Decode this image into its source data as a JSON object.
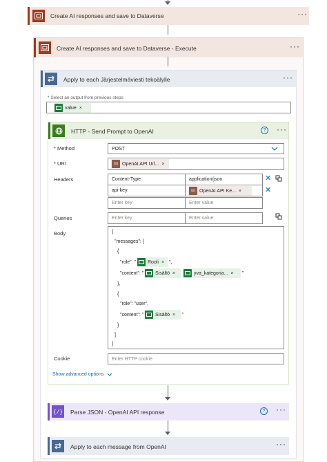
{
  "steps": {
    "create_ai": {
      "title": "Create AI responses and save to Dataverse",
      "menu": "···"
    },
    "create_ai_execute": {
      "title": "Create AI responses and save to Dataverse - Execute",
      "menu": "···"
    },
    "apply_each": {
      "title": "Apply to each Järjestelmäviesti tekoälylle",
      "menu": "···",
      "select_label": "* Select an output from previous steps",
      "selected_token": "value",
      "token_remove": "×"
    },
    "http": {
      "title": "HTTP - Send Prompt to OpenAI",
      "help": "?",
      "menu": "···",
      "method_label": "* Method",
      "method_value": "POST",
      "uri_label": "* URI",
      "uri_token": "OpenAI API Url...",
      "headers_label": "Headers",
      "headers": [
        {
          "key": "Content-Type",
          "value": "application/json"
        },
        {
          "key": "api-key",
          "value_token": "OpenAI API Ke..."
        }
      ],
      "enter_key": "Enter key",
      "enter_value": "Enter value",
      "queries_label": "Queries",
      "body_label": "Body",
      "body_lines": {
        "l1": "{",
        "l2": "\"messages\": [",
        "l3": "{",
        "l4_prefix": "\"role\": \"",
        "l4_token": "Rooli",
        "l4_suffix": "\",",
        "l5_prefix": "\"content\": \"",
        "l5_token1": "Sisältö",
        "l5_token2": "yva_kategoria...",
        "l5_suffix": "\"",
        "l6": "},",
        "l7": "{",
        "l8": "\"role\": \"user\",",
        "l9_prefix": "\"content\": \"",
        "l9_token": "Sisältö",
        "l9_suffix": "\"",
        "l10": "}",
        "l11": "]",
        "l12": "}"
      },
      "cookie_label": "Cookie",
      "cookie_placeholder": "Enter HTTP cookie",
      "show_advanced": "Show advanced options"
    },
    "parse_json": {
      "title": "Parse JSON - OpenAI API response",
      "help": "?",
      "menu": "···"
    },
    "apply_message": {
      "title": "Apply to each message from OpenAI",
      "menu": "···"
    }
  },
  "icons": {
    "dataverse": "dataverse-icon",
    "loop": "loop-icon",
    "http": "globe-icon",
    "parse": "code-braces-icon",
    "remove": "close-icon",
    "clear": "x-icon",
    "switch_mode": "switch-mode-icon"
  },
  "colors": {
    "dataverse_accent": "#a4381e",
    "loop_accent": "#486991",
    "http_accent": "#3c7b1e",
    "parse_accent": "#7552c7",
    "link_blue": "#0f6cbd"
  }
}
